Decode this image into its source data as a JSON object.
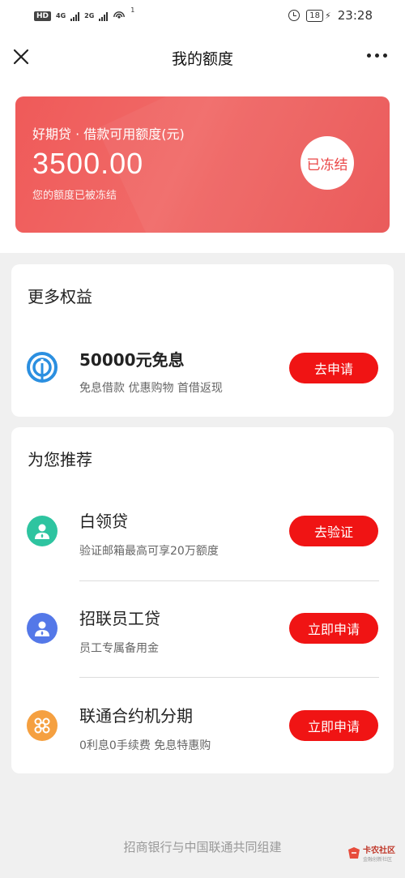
{
  "status_bar": {
    "hd": "HD",
    "net_1": "4G",
    "net_2": "2G",
    "hotspot_count": "1",
    "battery": "18",
    "time": "23:28"
  },
  "nav": {
    "title": "我的额度"
  },
  "credit": {
    "label": "好期贷 · 借款可用额度(元)",
    "amount": "3500.00",
    "note": "您的额度已被冻结",
    "status": "已冻结"
  },
  "benefits": {
    "title": "更多权益",
    "items": [
      {
        "title": "50000元免息",
        "subtitle": "免息借款 优惠购物 首借返现",
        "button": "去申请",
        "icon": "blue-ring-icon",
        "icon_color": "#2b8fe0"
      }
    ]
  },
  "recommend": {
    "title": "为您推荐",
    "items": [
      {
        "title": "白领贷",
        "subtitle": "验证邮箱最高可享20万额度",
        "button": "去验证",
        "icon": "person-icon",
        "icon_color": "#2ec4a0"
      },
      {
        "title": "招联员工贷",
        "subtitle": "员工专属备用金",
        "button": "立即申请",
        "icon": "person-icon",
        "icon_color": "#5478e8"
      },
      {
        "title": "联通合约机分期",
        "subtitle": "0利息0手续费 免息特惠购",
        "button": "立即申请",
        "icon": "unicom-knot-icon",
        "icon_color": "#f5a040"
      }
    ]
  },
  "footer": {
    "text": "招商银行与中国联通共同组建"
  },
  "watermark": {
    "text": "卡农社区",
    "sub": "金融创新社区"
  },
  "colors": {
    "accent_red": "#f01414",
    "card_red": "#ef5f5e",
    "page_bg": "#f0f0f0"
  }
}
